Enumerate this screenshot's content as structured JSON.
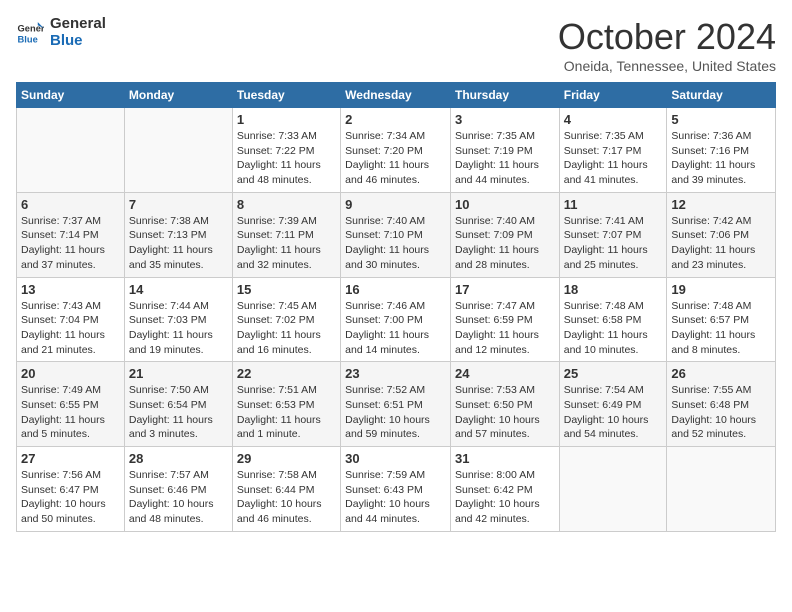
{
  "logo": {
    "text1": "General",
    "text2": "Blue"
  },
  "title": "October 2024",
  "location": "Oneida, Tennessee, United States",
  "headers": [
    "Sunday",
    "Monday",
    "Tuesday",
    "Wednesday",
    "Thursday",
    "Friday",
    "Saturday"
  ],
  "weeks": [
    [
      {
        "day": "",
        "detail": ""
      },
      {
        "day": "",
        "detail": ""
      },
      {
        "day": "1",
        "detail": "Sunrise: 7:33 AM\nSunset: 7:22 PM\nDaylight: 11 hours and 48 minutes."
      },
      {
        "day": "2",
        "detail": "Sunrise: 7:34 AM\nSunset: 7:20 PM\nDaylight: 11 hours and 46 minutes."
      },
      {
        "day": "3",
        "detail": "Sunrise: 7:35 AM\nSunset: 7:19 PM\nDaylight: 11 hours and 44 minutes."
      },
      {
        "day": "4",
        "detail": "Sunrise: 7:35 AM\nSunset: 7:17 PM\nDaylight: 11 hours and 41 minutes."
      },
      {
        "day": "5",
        "detail": "Sunrise: 7:36 AM\nSunset: 7:16 PM\nDaylight: 11 hours and 39 minutes."
      }
    ],
    [
      {
        "day": "6",
        "detail": "Sunrise: 7:37 AM\nSunset: 7:14 PM\nDaylight: 11 hours and 37 minutes."
      },
      {
        "day": "7",
        "detail": "Sunrise: 7:38 AM\nSunset: 7:13 PM\nDaylight: 11 hours and 35 minutes."
      },
      {
        "day": "8",
        "detail": "Sunrise: 7:39 AM\nSunset: 7:11 PM\nDaylight: 11 hours and 32 minutes."
      },
      {
        "day": "9",
        "detail": "Sunrise: 7:40 AM\nSunset: 7:10 PM\nDaylight: 11 hours and 30 minutes."
      },
      {
        "day": "10",
        "detail": "Sunrise: 7:40 AM\nSunset: 7:09 PM\nDaylight: 11 hours and 28 minutes."
      },
      {
        "day": "11",
        "detail": "Sunrise: 7:41 AM\nSunset: 7:07 PM\nDaylight: 11 hours and 25 minutes."
      },
      {
        "day": "12",
        "detail": "Sunrise: 7:42 AM\nSunset: 7:06 PM\nDaylight: 11 hours and 23 minutes."
      }
    ],
    [
      {
        "day": "13",
        "detail": "Sunrise: 7:43 AM\nSunset: 7:04 PM\nDaylight: 11 hours and 21 minutes."
      },
      {
        "day": "14",
        "detail": "Sunrise: 7:44 AM\nSunset: 7:03 PM\nDaylight: 11 hours and 19 minutes."
      },
      {
        "day": "15",
        "detail": "Sunrise: 7:45 AM\nSunset: 7:02 PM\nDaylight: 11 hours and 16 minutes."
      },
      {
        "day": "16",
        "detail": "Sunrise: 7:46 AM\nSunset: 7:00 PM\nDaylight: 11 hours and 14 minutes."
      },
      {
        "day": "17",
        "detail": "Sunrise: 7:47 AM\nSunset: 6:59 PM\nDaylight: 11 hours and 12 minutes."
      },
      {
        "day": "18",
        "detail": "Sunrise: 7:48 AM\nSunset: 6:58 PM\nDaylight: 11 hours and 10 minutes."
      },
      {
        "day": "19",
        "detail": "Sunrise: 7:48 AM\nSunset: 6:57 PM\nDaylight: 11 hours and 8 minutes."
      }
    ],
    [
      {
        "day": "20",
        "detail": "Sunrise: 7:49 AM\nSunset: 6:55 PM\nDaylight: 11 hours and 5 minutes."
      },
      {
        "day": "21",
        "detail": "Sunrise: 7:50 AM\nSunset: 6:54 PM\nDaylight: 11 hours and 3 minutes."
      },
      {
        "day": "22",
        "detail": "Sunrise: 7:51 AM\nSunset: 6:53 PM\nDaylight: 11 hours and 1 minute."
      },
      {
        "day": "23",
        "detail": "Sunrise: 7:52 AM\nSunset: 6:51 PM\nDaylight: 10 hours and 59 minutes."
      },
      {
        "day": "24",
        "detail": "Sunrise: 7:53 AM\nSunset: 6:50 PM\nDaylight: 10 hours and 57 minutes."
      },
      {
        "day": "25",
        "detail": "Sunrise: 7:54 AM\nSunset: 6:49 PM\nDaylight: 10 hours and 54 minutes."
      },
      {
        "day": "26",
        "detail": "Sunrise: 7:55 AM\nSunset: 6:48 PM\nDaylight: 10 hours and 52 minutes."
      }
    ],
    [
      {
        "day": "27",
        "detail": "Sunrise: 7:56 AM\nSunset: 6:47 PM\nDaylight: 10 hours and 50 minutes."
      },
      {
        "day": "28",
        "detail": "Sunrise: 7:57 AM\nSunset: 6:46 PM\nDaylight: 10 hours and 48 minutes."
      },
      {
        "day": "29",
        "detail": "Sunrise: 7:58 AM\nSunset: 6:44 PM\nDaylight: 10 hours and 46 minutes."
      },
      {
        "day": "30",
        "detail": "Sunrise: 7:59 AM\nSunset: 6:43 PM\nDaylight: 10 hours and 44 minutes."
      },
      {
        "day": "31",
        "detail": "Sunrise: 8:00 AM\nSunset: 6:42 PM\nDaylight: 10 hours and 42 minutes."
      },
      {
        "day": "",
        "detail": ""
      },
      {
        "day": "",
        "detail": ""
      }
    ]
  ]
}
